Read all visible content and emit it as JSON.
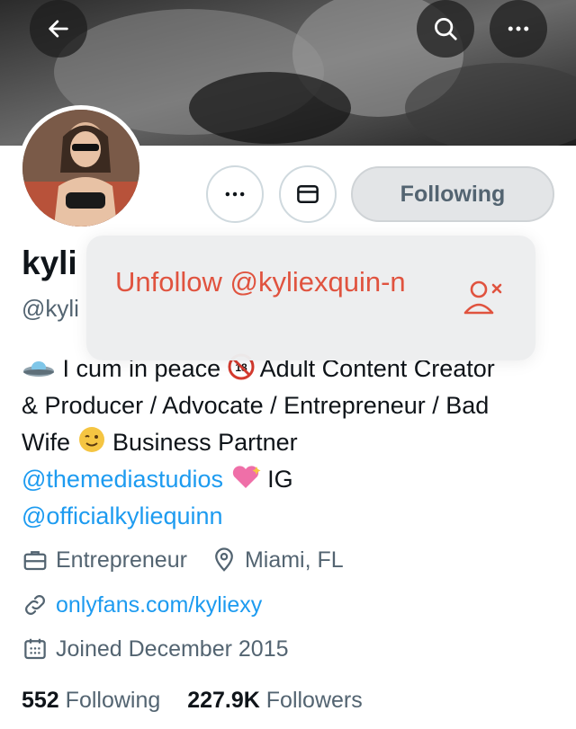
{
  "header": {
    "back_icon": "arrow-left-icon",
    "search_icon": "search-icon",
    "more_icon": "more-horizontal-icon"
  },
  "profile": {
    "name_visible": "kyli",
    "handle_visible": "@kyli",
    "buttons": {
      "more_icon": "more-horizontal-icon",
      "message_icon": "envelope-icon",
      "following_label": "Following"
    }
  },
  "popup": {
    "label": "Unfollow @kyliexquin-n",
    "icon": "person-remove-icon",
    "color": "#e0533f"
  },
  "bio": {
    "line1_text": "I cum in peace",
    "line1_text2": "Adult Content Creator",
    "line2": "& Producer / Advocate / Entrepreneur / Bad",
    "line3_a": "Wife",
    "line3_b": "Business Partner",
    "mention1": "@themediastudios",
    "ig": "IG",
    "mention2": "@officialkyliequinn"
  },
  "details": {
    "profession": "Entrepreneur",
    "location": "Miami, FL",
    "website": "onlyfans.com/kyliexy",
    "joined": "Joined December 2015"
  },
  "stats": {
    "following_count": "552",
    "following_label": "Following",
    "followers_count": "227.9K",
    "followers_label": "Followers"
  },
  "colors": {
    "accent": "#1d9bf0",
    "muted": "#536471",
    "danger": "#e0533f"
  }
}
